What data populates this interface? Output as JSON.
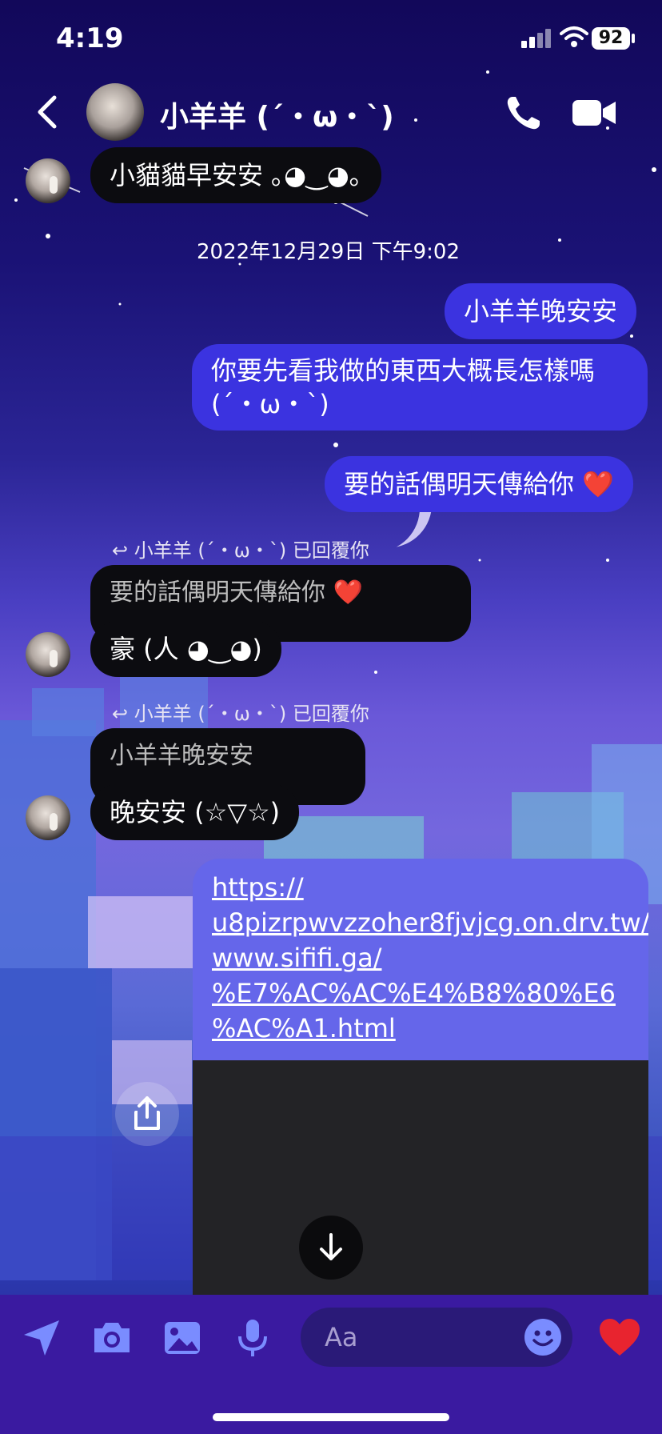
{
  "status_bar": {
    "time": "4:19",
    "battery": "92"
  },
  "header": {
    "contact_name": "小羊羊 (´・ω・`)"
  },
  "messages": {
    "m1": "小貓貓早安安 ｡◕‿◕｡",
    "timestamp": "2022年12月29日 下午9:02",
    "m2": "小羊羊晚安安",
    "m3_line1": "你要先看我做的東西大概長怎樣嗎",
    "m3_line2": "(´・ω・`)",
    "m4": "要的話偶明天傳給你 ❤️",
    "reply1_label": "小羊羊 (´・ω・`) 已回覆你",
    "reply1_quote": "要的話偶明天傳給你 ❤️",
    "m5": "豪 (人 ◕‿◕)",
    "reply2_label": "小羊羊 (´・ω・`) 已回覆你",
    "reply2_quote": "小羊羊晚安安",
    "m6": "晚安安 (☆▽☆)",
    "link_lines": [
      "https://",
      "u8pizrpwvzzoher8fjvjcg.on.drv.tw/",
      "www.sififi.ga/",
      "%E7%AC%AC%E4%B8%80%E6",
      "%AC%A1.html"
    ]
  },
  "composer": {
    "placeholder": "Aa"
  },
  "colors": {
    "outgoing": "#3b33e0",
    "incoming": "#0c0c10",
    "link_card": "#6566ea",
    "bottom_bar": "#3a1aa0"
  }
}
